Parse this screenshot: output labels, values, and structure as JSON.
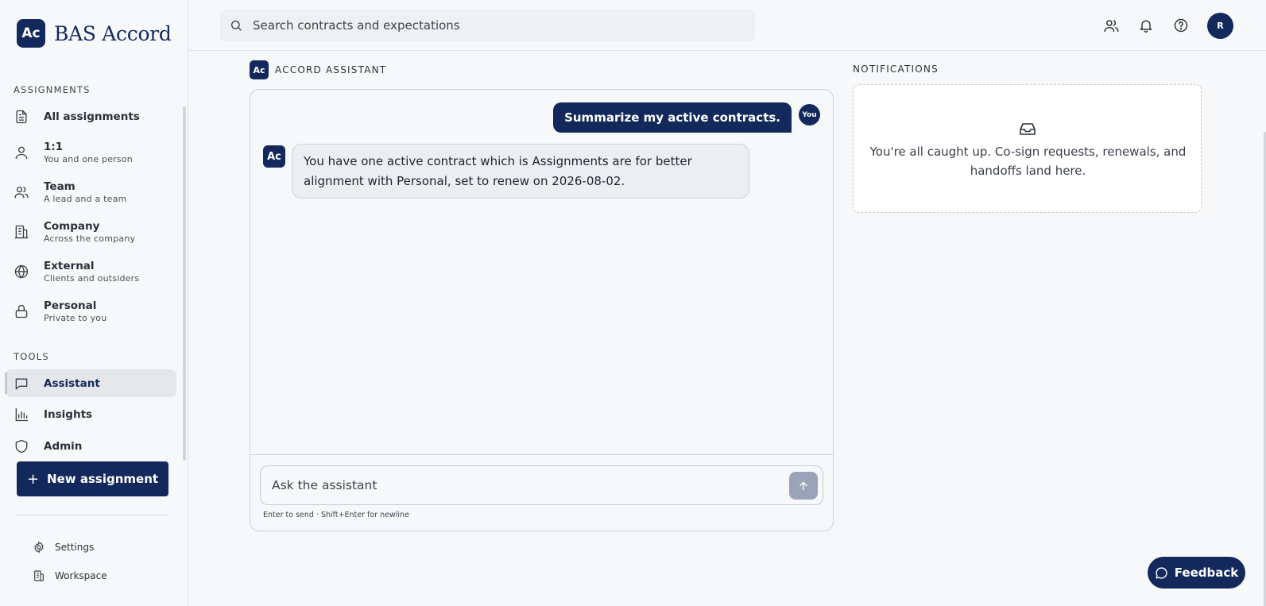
{
  "brand": {
    "logo": "Ac",
    "name": "BAS Accord"
  },
  "sidebar": {
    "assignments_label": "ASSIGNMENTS",
    "assignments": [
      {
        "label": "All assignments",
        "sub": "",
        "icon": "document-icon"
      },
      {
        "label": "1:1",
        "sub": "You and one person",
        "icon": "user-icon"
      },
      {
        "label": "Team",
        "sub": "A lead and a team",
        "icon": "users-icon"
      },
      {
        "label": "Company",
        "sub": "Across the company",
        "icon": "building-icon"
      },
      {
        "label": "External",
        "sub": "Clients and outsiders",
        "icon": "globe-icon"
      },
      {
        "label": "Personal",
        "sub": "Private to you",
        "icon": "lock-icon"
      }
    ],
    "tools_label": "TOOLS",
    "tools": [
      {
        "label": "Assistant",
        "icon": "chat-icon",
        "active": true
      },
      {
        "label": "Insights",
        "icon": "bar-chart-icon"
      },
      {
        "label": "Admin",
        "icon": "shield-icon"
      }
    ],
    "new_button": "New assignment",
    "footer": [
      {
        "label": "Settings",
        "icon": "gear-icon"
      },
      {
        "label": "Workspace",
        "icon": "building-icon"
      }
    ]
  },
  "topbar": {
    "search_placeholder": "Search contracts and expectations",
    "avatar": "R"
  },
  "assistant": {
    "logo": "Ac",
    "title": "ACCORD ASSISTANT",
    "user_message": "Summarize my active contracts.",
    "user_badge": "You",
    "bot_message": "You have one active contract which is Assignments are for better alignment with Personal, set to renew on 2026-08-02.",
    "input_placeholder": "Ask the assistant",
    "hint": "Enter to send · Shift+Enter for newline"
  },
  "notifications": {
    "title": "NOTIFICATIONS",
    "empty_message": "You're all caught up. Co-sign requests, renewals, and handoffs land here."
  },
  "feedback_label": "Feedback",
  "colors": {
    "brand": "#13295c",
    "background": "#f7f8fa"
  }
}
